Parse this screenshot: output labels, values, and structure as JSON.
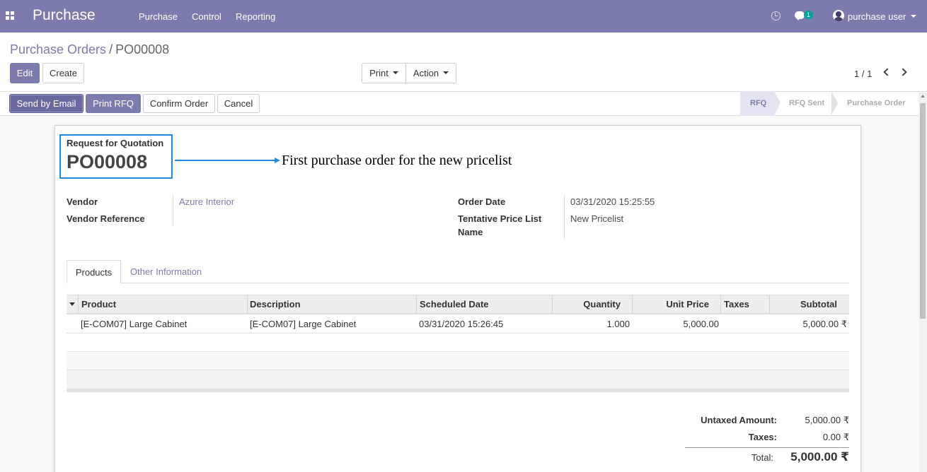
{
  "navbar": {
    "brand": "Purchase",
    "menu": [
      "Purchase",
      "Control",
      "Reporting"
    ],
    "chat_count": "1",
    "user_name": "purchase user"
  },
  "breadcrumb": {
    "parent": "Purchase Orders",
    "separator": "/",
    "current": "PO00008"
  },
  "control": {
    "edit": "Edit",
    "create": "Create",
    "print": "Print",
    "action": "Action",
    "pager": "1 / 1"
  },
  "statusbar": {
    "buttons": [
      "Send by Email",
      "Print RFQ",
      "Confirm Order",
      "Cancel"
    ],
    "stages": [
      "RFQ",
      "RFQ Sent",
      "Purchase Order"
    ],
    "active_stage": "RFQ"
  },
  "sheet": {
    "doc_type": "Request for Quotation",
    "doc_name": "PO00008",
    "annotation": "First purchase order for the new pricelist",
    "fields": {
      "vendor_label": "Vendor",
      "vendor_value": "Azure Interior",
      "vendor_ref_label": "Vendor Reference",
      "vendor_ref_value": "",
      "order_date_label": "Order Date",
      "order_date_value": "03/31/2020 15:25:55",
      "pricelist_label_1": "Tentative Price List",
      "pricelist_label_2": "Name",
      "pricelist_value": "New Pricelist"
    },
    "tabs": [
      "Products",
      "Other Information"
    ],
    "table": {
      "columns": [
        "Product",
        "Description",
        "Scheduled Date",
        "Quantity",
        "Unit Price",
        "Taxes",
        "Subtotal"
      ],
      "rows": [
        [
          "[E-COM07] Large Cabinet",
          "[E-COM07] Large Cabinet",
          "03/31/2020 15:26:45",
          "1.000",
          "5,000.00",
          "",
          "5,000.00 ₹"
        ]
      ]
    },
    "totals": {
      "untaxed_label": "Untaxed Amount:",
      "untaxed_value": "5,000.00 ₹",
      "taxes_label": "Taxes:",
      "taxes_value": "0.00 ₹",
      "total_label": "Total:",
      "total_value": "5,000.00 ₹"
    }
  },
  "colors": {
    "brand": "#7c7bad",
    "annotation_blue": "#1e88e5"
  }
}
